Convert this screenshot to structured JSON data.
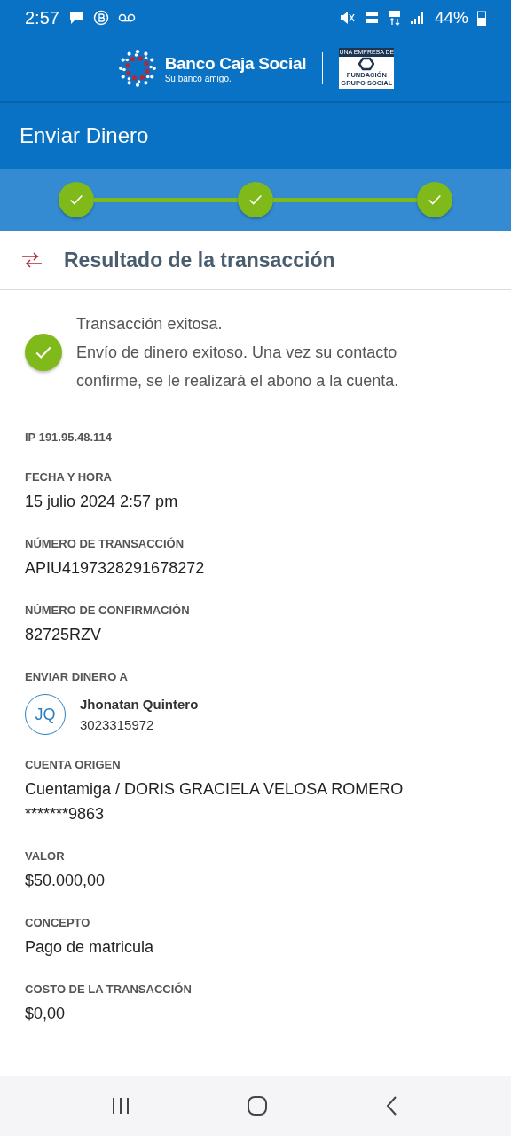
{
  "status_bar": {
    "time": "2:57",
    "battery": "44%"
  },
  "brand": {
    "name": "Banco Caja Social",
    "tagline": "Su banco amigo.",
    "partner_caption": "UNA EMPRESA DE",
    "partner_name": "FUNDACIÓN GRUPO SOCIAL"
  },
  "title": "Enviar Dinero",
  "steps": [
    {
      "done": true
    },
    {
      "done": true
    },
    {
      "done": true
    }
  ],
  "section_title": "Resultado de la transacción",
  "result": {
    "success": true,
    "title": "Transacción exitosa.",
    "message": "Envío de dinero exitoso. Una vez su contacto confirme, se le realizará el abono a la cuenta."
  },
  "ip": "IP 191.95.48.114",
  "fields": [
    {
      "kind": "text",
      "label": "FECHA Y HORA",
      "value": "15 julio 2024 2:57 pm"
    },
    {
      "kind": "text",
      "label": "NÚMERO DE TRANSACCIÓN",
      "value": "APIU4197328291678272"
    },
    {
      "kind": "text",
      "label": "NÚMERO DE CONFIRMACIÓN",
      "value": "82725RZV"
    },
    {
      "kind": "contact",
      "label": "ENVIAR DINERO A",
      "initials": "JQ",
      "name": "Jhonatan Quintero",
      "phone": "3023315972"
    },
    {
      "kind": "text",
      "label": "CUENTA ORIGEN",
      "value": "Cuentamiga / DORIS GRACIELA VELOSA ROMERO *******9863"
    },
    {
      "kind": "text",
      "label": "VALOR",
      "value": "$50.000,00"
    },
    {
      "kind": "text",
      "label": "CONCEPTO",
      "value": "Pago de matricula"
    },
    {
      "kind": "text",
      "label": "COSTO DE LA TRANSACCIÓN",
      "value": "$0,00"
    }
  ]
}
